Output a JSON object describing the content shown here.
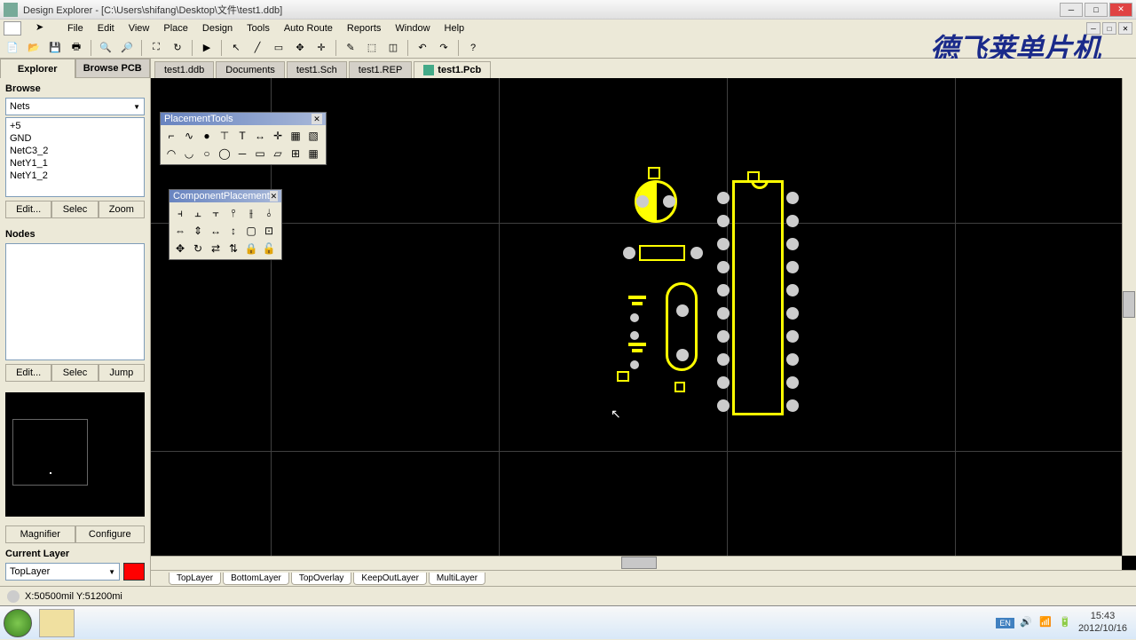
{
  "window": {
    "title": "Design Explorer - [C:\\Users\\shifang\\Desktop\\文件\\test1.ddb]"
  },
  "menubar": [
    "File",
    "Edit",
    "View",
    "Place",
    "Design",
    "Tools",
    "Auto Route",
    "Reports",
    "Window",
    "Help"
  ],
  "watermark": "德飞莱单片机",
  "sidebar": {
    "tabs": [
      "Explorer",
      "Browse PCB"
    ],
    "active_tab": 0,
    "browse_label": "Browse",
    "dropdown_value": "Nets",
    "nets": [
      "+5",
      "GND",
      "NetC3_2",
      "NetY1_1",
      "NetY1_2"
    ],
    "btn_edit": "Edit...",
    "btn_select": "Selec",
    "btn_zoom": "Zoom",
    "nodes_label": "Nodes",
    "btn_jump": "Jump",
    "magnifier": "Magnifier",
    "configure": "Configure",
    "current_layer_label": "Current Layer",
    "current_layer": "TopLayer"
  },
  "doc_tabs": [
    "test1.ddb",
    "Documents",
    "test1.Sch",
    "test1.REP",
    "test1.Pcb"
  ],
  "active_doc_tab": 4,
  "layer_tabs": [
    "TopLayer",
    "BottomLayer",
    "TopOverlay",
    "KeepOutLayer",
    "MultiLayer"
  ],
  "floating": {
    "placement_title": "PlacementTools",
    "component_title": "ComponentPlacement"
  },
  "statusbar": {
    "coords": "X:50500mil Y:51200mi"
  },
  "taskbar": {
    "lang": "EN",
    "time": "15:43",
    "date": "2012/10/16"
  }
}
